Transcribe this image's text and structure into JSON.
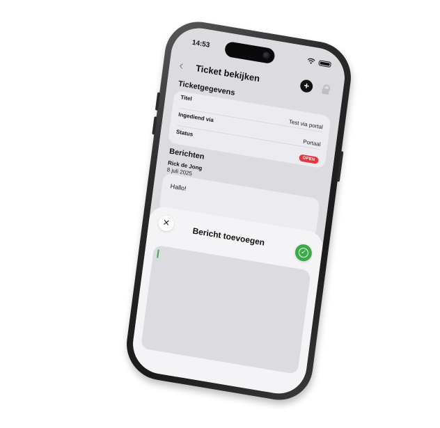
{
  "status_bar": {
    "time": "14:53"
  },
  "nav": {
    "back_icon": "chevron-left-icon",
    "title": "Ticket bekijken",
    "chat_icon": "add-comment-icon",
    "lock_icon": "lock-icon"
  },
  "ticket": {
    "section_title": "Ticketgegevens",
    "rows": [
      {
        "label": "Titel",
        "value": "Test via portal"
      },
      {
        "label": "Ingediend via",
        "value": "Portaal"
      },
      {
        "label": "Status",
        "value": "OPEN"
      }
    ],
    "status_color": "#e0393e"
  },
  "messages": {
    "section_title": "Berichten",
    "items": [
      {
        "author": "Rick de Jong",
        "date": "8 juli 2025",
        "text": "Hallo!"
      }
    ]
  },
  "sheet": {
    "title": "Bericht toevoegen",
    "close_icon": "close-icon",
    "confirm_icon": "checkmark-icon",
    "confirm_color": "#3caa4a",
    "input_value": ""
  }
}
